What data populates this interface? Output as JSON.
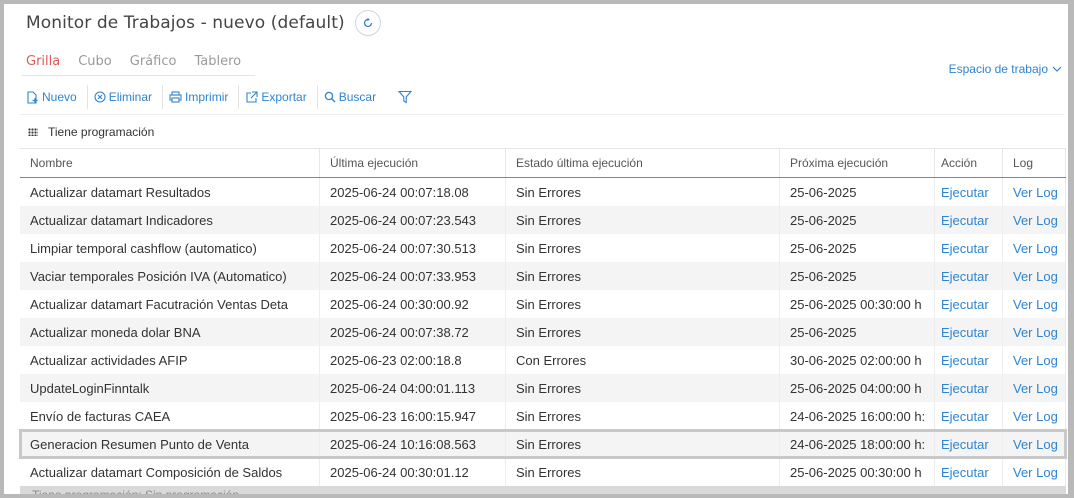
{
  "header": {
    "title": "Monitor de Trabajos - nuevo (default)",
    "refresh_icon": "refresh-icon"
  },
  "tabs": [
    {
      "label": "Grilla",
      "active": true
    },
    {
      "label": "Cubo",
      "active": false
    },
    {
      "label": "Gráfico",
      "active": false
    },
    {
      "label": "Tablero",
      "active": false
    }
  ],
  "workspace": {
    "label": "Espacio de trabajo",
    "icon": "chevron-down-icon"
  },
  "toolbar": {
    "nuevo": "Nuevo",
    "eliminar": "Eliminar",
    "imprimir": "Imprimir",
    "exportar": "Exportar",
    "buscar": "Buscar",
    "filter_icon": "filter-icon"
  },
  "group": {
    "label": "Tiene programación"
  },
  "table": {
    "columns": [
      "Nombre",
      "Última ejecución",
      "Estado última ejecución",
      "Próxima ejecución",
      "Acción",
      "Log"
    ],
    "rows": [
      {
        "name": "Actualizar datamart Resultados",
        "last": "2025-06-24 00:07:18.08",
        "state": "Sin Errores",
        "next": "25-06-2025",
        "action": "Ejecutar",
        "log": "Ver Log"
      },
      {
        "name": "Actualizar datamart Indicadores",
        "last": "2025-06-24 00:07:23.543",
        "state": "Sin Errores",
        "next": "25-06-2025",
        "action": "Ejecutar",
        "log": "Ver Log"
      },
      {
        "name": "Limpiar temporal cashflow (automatico)",
        "last": "2025-06-24 00:07:30.513",
        "state": "Sin Errores",
        "next": "25-06-2025",
        "action": "Ejecutar",
        "log": "Ver Log"
      },
      {
        "name": "Vaciar temporales Posición IVA (Automatico)",
        "last": "2025-06-24 00:07:33.953",
        "state": "Sin Errores",
        "next": "25-06-2025",
        "action": "Ejecutar",
        "log": "Ver Log"
      },
      {
        "name": "Actualizar datamart Facutración Ventas Deta",
        "last": "2025-06-24 00:30:00.92",
        "state": "Sin Errores",
        "next": "25-06-2025 00:30:00 h",
        "action": "Ejecutar",
        "log": "Ver Log"
      },
      {
        "name": "Actualizar moneda dolar BNA",
        "last": "2025-06-24 00:07:38.72",
        "state": "Sin Errores",
        "next": "25-06-2025",
        "action": "Ejecutar",
        "log": "Ver Log"
      },
      {
        "name": "Actualizar actividades AFIP",
        "last": "2025-06-23 02:00:18.8",
        "state": "Con Errores",
        "next": "30-06-2025 02:00:00 h",
        "action": "Ejecutar",
        "log": "Ver Log"
      },
      {
        "name": "UpdateLoginFinntalk",
        "last": "2025-06-24 04:00:01.113",
        "state": "Sin Errores",
        "next": "25-06-2025 04:00:00 h",
        "action": "Ejecutar",
        "log": "Ver Log"
      },
      {
        "name": "Envío de facturas CAEA",
        "last": "2025-06-23 16:00:15.947",
        "state": "Sin Errores",
        "next": "24-06-2025 16:00:00 h:",
        "action": "Ejecutar",
        "log": "Ver Log"
      },
      {
        "name": "Generacion Resumen Punto de Venta",
        "last": "2025-06-24 10:16:08.563",
        "state": "Sin Errores",
        "next": "24-06-2025 18:00:00 h:",
        "action": "Ejecutar",
        "log": "Ver Log"
      },
      {
        "name": "Actualizar datamart Composición de Saldos",
        "last": "2025-06-24 00:30:01.12",
        "state": "Sin Errores",
        "next": "25-06-2025 00:30:00 h",
        "action": "Ejecutar",
        "log": "Ver Log"
      }
    ],
    "selected_row": 9
  },
  "footer_group": {
    "label": "Tiene programación: Sin programación"
  }
}
